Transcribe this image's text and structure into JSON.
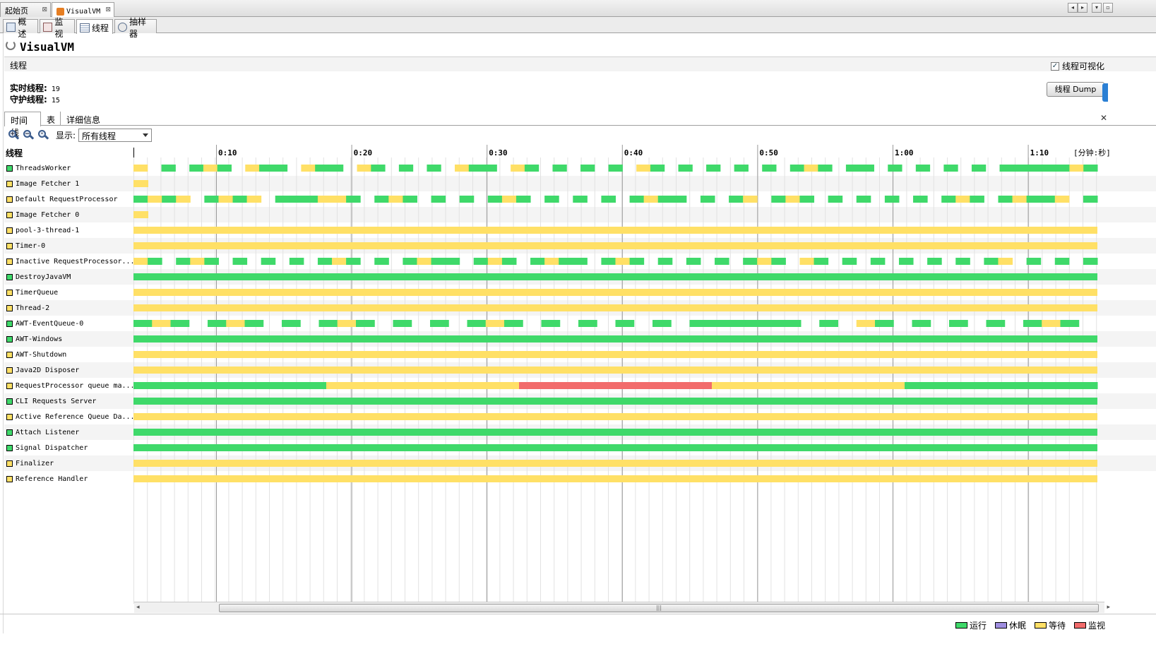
{
  "doc_tabs": [
    {
      "label": "起始页",
      "close": "⊠"
    },
    {
      "label": "VisualVM",
      "close": "⊠"
    }
  ],
  "view_tabs": [
    {
      "label": "概述",
      "icon": "overview-icon"
    },
    {
      "label": "监视",
      "icon": "monitor-icon"
    },
    {
      "label": "线程",
      "icon": "threads-icon"
    },
    {
      "label": "抽样器",
      "icon": "sampler-icon"
    }
  ],
  "app_title": "VisualVM",
  "section_title": "线程",
  "visualize_label": "线程可视化",
  "visualize_checked": true,
  "stats": {
    "live_label": "实时线程:",
    "live_value": "19",
    "daemon_label": "守护线程:",
    "daemon_value": "15"
  },
  "dump_button": "线程 Dump",
  "sub_tabs": [
    "时间线",
    "表",
    "详细信息"
  ],
  "toolbar": {
    "show_label": "显示:",
    "show_value": "所有线程"
  },
  "column_header": "线程",
  "time_ticks": [
    "0:10",
    "0:20",
    "0:30",
    "0:40",
    "0:50",
    "1:00",
    "1:10"
  ],
  "time_unit": "[分钟:秒]",
  "colors": {
    "running": "#3fd96a",
    "sleeping": "#9f8ee0",
    "waiting": "#ffe066",
    "monitor": "#f26b6b"
  },
  "threads": [
    {
      "name": "ThreadsWorker",
      "state": "running",
      "segs": "ywgwgygwyggwyggwygwgwgwyggwygwgwgwgwygwgwgwgwgwgygwggwgwgwgwgwgggggyg"
    },
    {
      "name": "Image Fetcher 1",
      "state": "waiting",
      "segs": "y"
    },
    {
      "name": "Default RequestProcessor",
      "state": "waiting",
      "segs": "gygywgygywgggyygwgygwgwgwgygwgwgwgwgyggwgwgywgygwgwgwgwgwgygwgyggywg"
    },
    {
      "name": "Image Fetcher 0",
      "state": "waiting",
      "segs": "y"
    },
    {
      "name": "pool-3-thread-1",
      "state": "waiting",
      "segs": "Y"
    },
    {
      "name": "Timer-0",
      "state": "waiting",
      "segs": "Y"
    },
    {
      "name": "Inactive RequestProcessor...",
      "state": "waiting",
      "segs": "ygwgygwgwgwgwgygwgwgyggwgygwgyggwgygwgwgwgwgygwygwgwgwgwgwgwgywgwgwg"
    },
    {
      "name": "DestroyJavaVM",
      "state": "running",
      "segs": "G"
    },
    {
      "name": "TimerQueue",
      "state": "waiting",
      "segs": "Y"
    },
    {
      "name": "Thread-2",
      "state": "waiting",
      "segs": "Y"
    },
    {
      "name": "AWT-EventQueue-0",
      "state": "running",
      "segs": "gygwgygwgwgygwgwgwgygwgwgwgwgwggggggwgwygwgwgwgwgygw"
    },
    {
      "name": "AWT-Windows",
      "state": "running",
      "segs": "G"
    },
    {
      "name": "AWT-Shutdown",
      "state": "waiting",
      "segs": "Y"
    },
    {
      "name": "Java2D Disposer",
      "state": "waiting",
      "segs": "Y"
    },
    {
      "name": "RequestProcessor queue ma...",
      "state": "waiting",
      "segs": "gyryg"
    },
    {
      "name": "CLI Requests Server",
      "state": "running",
      "segs": "G"
    },
    {
      "name": "Active Reference Queue Da...",
      "state": "waiting",
      "segs": "Y"
    },
    {
      "name": "Attach Listener",
      "state": "running",
      "segs": "G"
    },
    {
      "name": "Signal Dispatcher",
      "state": "running",
      "segs": "G"
    },
    {
      "name": "Finalizer",
      "state": "waiting",
      "segs": "Y"
    },
    {
      "name": "Reference Handler",
      "state": "waiting",
      "segs": "Y"
    }
  ],
  "legend": [
    {
      "label": "运行",
      "color": "#3fd96a"
    },
    {
      "label": "休眠",
      "color": "#9f8ee0"
    },
    {
      "label": "等待",
      "color": "#ffe066"
    },
    {
      "label": "监视",
      "color": "#f26b6b"
    }
  ]
}
